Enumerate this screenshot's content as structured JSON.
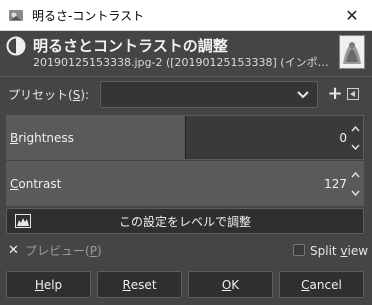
{
  "window": {
    "title": "明るさ-コントラスト",
    "close_glyph": "✕",
    "icon": "gimp-app-icon"
  },
  "header": {
    "title": "明るさとコントラストの調整",
    "subtitle": "20190125153338.jpg-2 ([20190125153338] (インポートさ...",
    "icon": "brightness-contrast-icon"
  },
  "presets": {
    "label_prefix": "プリセット(",
    "label_key": "S",
    "label_suffix": "):",
    "selected": "",
    "add_glyph": "+"
  },
  "brightness": {
    "label_key": "B",
    "label_rest": "rightness",
    "value": "0",
    "fraction": 0.5
  },
  "contrast": {
    "label_key": "C",
    "label_rest": "ontrast",
    "value": "127",
    "fraction": 1.0
  },
  "levels_button": {
    "label": "この設定をレベルで調整"
  },
  "preview": {
    "check_glyph": "✕",
    "label_prefix": "プレビュー(",
    "label_key": "P",
    "label_suffix": ")",
    "checked": true
  },
  "split_view": {
    "label_prefix": "Split ",
    "label_key": "v",
    "label_suffix": "iew",
    "checked": false
  },
  "buttons": {
    "help_key": "H",
    "help_rest": "elp",
    "reset_key": "R",
    "reset_rest": "eset",
    "ok_key": "O",
    "ok_rest": "K",
    "cancel_key": "C",
    "cancel_rest": "ancel"
  }
}
